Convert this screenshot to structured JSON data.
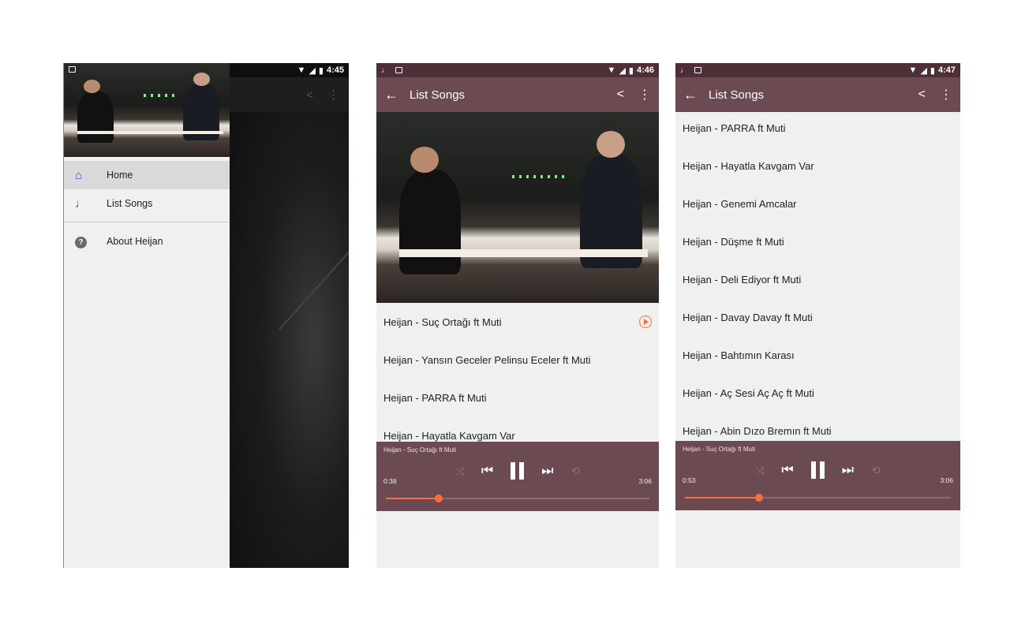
{
  "screen1": {
    "status": {
      "time": "4:45"
    },
    "menu": [
      {
        "icon": "home-icon",
        "label": "Home",
        "active": true
      },
      {
        "icon": "music-note-icon",
        "label": "List Songs",
        "active": false
      },
      {
        "icon": "help-icon",
        "label": "About Heijan",
        "active": false
      }
    ]
  },
  "screen2": {
    "status": {
      "time": "4:46"
    },
    "toolbar": {
      "title": "List Songs"
    },
    "songs": [
      "Heijan - Suç Ortağı ft Muti",
      "Heijan - Yansın Geceler Pelinsu Eceler ft Muti",
      "Heijan - PARRA ft Muti",
      "Heijan - Hayatla Kavgam Var"
    ],
    "player": {
      "now_playing": "Heijan - Suç Ortağı ft Muti",
      "current": "0:38",
      "total": "3:06",
      "progress": 0.2
    }
  },
  "screen3": {
    "status": {
      "time": "4:47"
    },
    "toolbar": {
      "title": "List Songs"
    },
    "songs": [
      "Heijan - PARRA ft Muti",
      "Heijan - Hayatla Kavgam Var",
      "Heijan - Genemi Amcalar",
      "Heijan - Düşme ft Muti",
      "Heijan - Deli Ediyor ft Muti",
      "Heijan - Davay Davay ft Muti",
      "Heijan - Bahtımın Karası",
      "Heijan - Aç Sesi Aç Aç ft Muti",
      "Heijan - Abin Dızo Bremın ft Muti"
    ],
    "player": {
      "now_playing": "Heijan - Suç Ortağı ft Muti",
      "current": "0:53",
      "total": "3:06",
      "progress": 0.28
    }
  },
  "colors": {
    "toolbar": "#6b4a51",
    "statusbar": "#4e2f38",
    "accent": "#ff6d3b",
    "active_icon": "#3f51b5"
  }
}
